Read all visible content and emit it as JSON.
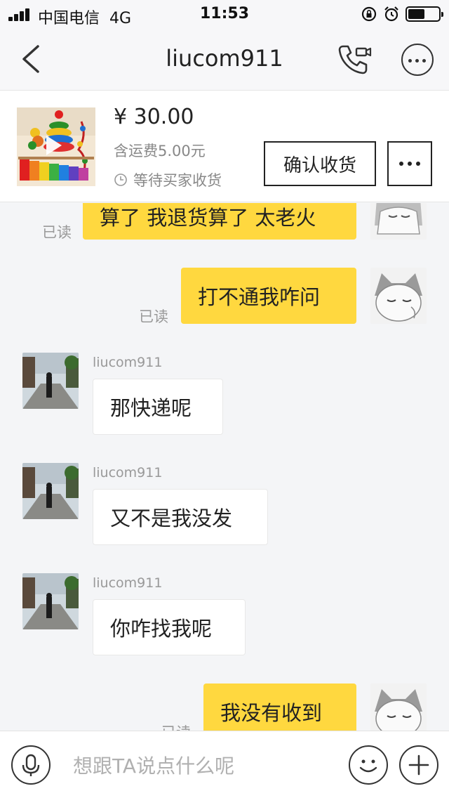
{
  "status_bar": {
    "carrier": "中国电信",
    "network": "4G",
    "time": "11:53",
    "battery_level": 0.55
  },
  "nav": {
    "title": "liucom911",
    "icons": [
      "back-chevron-icon",
      "phone-call-icon",
      "more-circle-icon"
    ]
  },
  "product": {
    "price": "¥ 30.00",
    "shipping": "含运费5.00元",
    "status": "等待买家收货",
    "confirm_label": "确认收货",
    "more_icon": "ellipsis-icon"
  },
  "chat": {
    "messages": [
      {
        "from": "me",
        "text": "算了 我退货算了 太老火",
        "read": "已读"
      },
      {
        "from": "me",
        "text": "打不通我咋问",
        "read": "已读"
      },
      {
        "from": "them",
        "sender": "liucom911",
        "text": "那快递呢"
      },
      {
        "from": "them",
        "sender": "liucom911",
        "text": "又不是我没发"
      },
      {
        "from": "them",
        "sender": "liucom911",
        "text": "你咋找我呢"
      },
      {
        "from": "me",
        "text": "我没有收到",
        "read": "已读"
      }
    ]
  },
  "input": {
    "placeholder": "想跟TA说点什么呢",
    "icons": [
      "microphone-icon",
      "emoji-icon",
      "plus-icon"
    ]
  },
  "colors": {
    "my_bubble": "#ffd83f",
    "their_bubble": "#ffffff",
    "background": "#f4f5f7"
  }
}
